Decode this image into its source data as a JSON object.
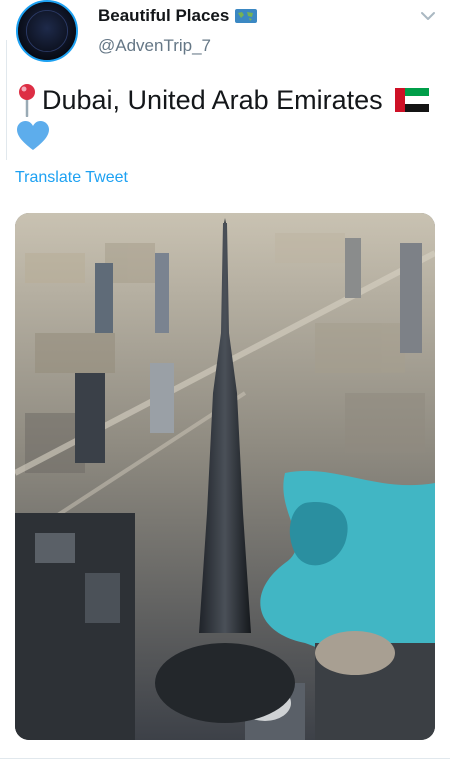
{
  "account": {
    "display_name": "Beautiful Places",
    "name_icon": "world-map-icon",
    "handle": "@AdvenTrip_7"
  },
  "tweet": {
    "text": "Dubai, United Arab Emirates",
    "emojis": [
      "round-pushpin-icon",
      "uae-flag-icon",
      "blue-heart-icon"
    ],
    "translate_label": "Translate Tweet"
  },
  "media": {
    "description_icon": "photo"
  },
  "colors": {
    "accent": "#1da1f2",
    "text": "#14171a",
    "secondary": "#657786",
    "heart": "#5dadec"
  }
}
